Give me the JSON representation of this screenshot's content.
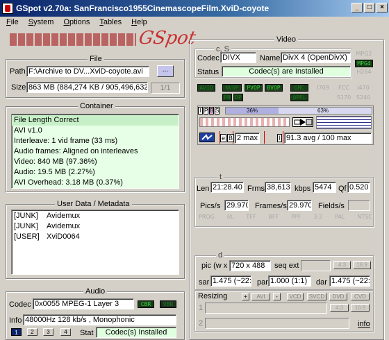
{
  "window": {
    "title": "GSpot v2.70a: SanFrancisco1955CinemascopeFilm.XviD-coyote",
    "min": "_",
    "max": "□",
    "close": "×"
  },
  "menu": [
    "File",
    "System",
    "Options",
    "Tables",
    "Help"
  ],
  "logo": "GSpot",
  "file": {
    "title": "File",
    "path_label": "Path",
    "path": "F:\\Archive to DV...XviD-coyote.avi",
    "browse": "...",
    "size_label": "Size",
    "size": "863 MB (884,274 KB / 905,496,632",
    "part": "1/1"
  },
  "container": {
    "title": "Container",
    "lines": [
      "File Length Correct",
      "AVI v1.0",
      "Interleave: 1 vid frame (33 ms)",
      "Audio frames: Aligned on interleaves",
      "Video: 840 MB (97.36%)",
      "Audio: 19.5 MB (2.27%)",
      "AVI Overhead: 3.18 MB (0.37%)"
    ]
  },
  "userdata": {
    "title": "User Data / Metadata",
    "rows": [
      {
        "tag": "[JUNK]",
        "val": "Avidemux"
      },
      {
        "tag": "[JUNK]",
        "val": "Avidemux"
      },
      {
        "tag": "[USER]",
        "val": "XviD0064"
      }
    ]
  },
  "audio": {
    "title": "Audio",
    "codec_label": "Codec",
    "codec": "0x0055 MPEG-1 Layer 3",
    "cbr": "CBR",
    "vbr": "VBR",
    "info_label": "Info",
    "info": "48000Hz  128 kb/s , Monophonic",
    "tabs": [
      "1",
      "2",
      "3",
      "4"
    ],
    "stat_label": "Stat",
    "stat": "Codec(s) Installed"
  },
  "video": {
    "title": "Video",
    "cs": "c, S",
    "codec_label": "Codec",
    "codec": "DIVX",
    "name_label": "Name",
    "name": "DivX 4 (OpenDivX)",
    "mpg2": "MPG2",
    "mpg4": "MPG4",
    "h264": "H264",
    "status_label": "Status",
    "status": "Codec(s) are Installed",
    "tags_on": [
      "AVID",
      "NVOP",
      "PVOP",
      "BVOP",
      "GMC",
      "PB",
      "DP",
      "QPEL"
    ],
    "tags_off": [
      "I709",
      "FCC",
      "I470",
      "S170",
      "S240"
    ],
    "ipbs": [
      "I",
      "P",
      "B",
      "S"
    ],
    "pct1": "36%",
    "pct2": "63%",
    "maxb": "2 max",
    "bitrate": "91.3 avg / 100 max",
    "e": "e",
    "b": "B",
    "i": "I"
  },
  "t": {
    "title": "t",
    "len_label": "Len",
    "len": "21:28.40",
    "frms_label": "Frms",
    "frms": "38,613",
    "kbps_label": "kbps",
    "kbps": "5474",
    "qf_label": "Qf",
    "qf": "0.520",
    "pics_label": "Pics/s",
    "pics": "29.970",
    "frames_label": "Frames/s",
    "frames": "29.970",
    "fields_label": "Fields/s",
    "flags": [
      "PROG",
      "I/L",
      "TFF",
      "BFF",
      "PPF",
      "3:2",
      "PAL",
      "NTSC"
    ]
  },
  "d": {
    "title": "d",
    "pic_label": "pic (w x",
    "pic": "720 x 488",
    "seqext_label": "seq ext",
    "r43": "4:3",
    "r169": "16:9",
    "sar_label": "sar",
    "sar": "1.475 (~22:",
    "par_label": "par",
    "par": "1.000 (1:1)",
    "dar_label": "dar",
    "dar": "1.475 (~22:",
    "resizing": "Resizing",
    "rs_btns": [
      "+",
      "AVI",
      "-",
      "VCD",
      "SVCD",
      "DVD",
      "CVD"
    ],
    "r1": "1",
    "r2": "2",
    "b43": "4:3",
    "b169": "16:9",
    "info": "info"
  }
}
